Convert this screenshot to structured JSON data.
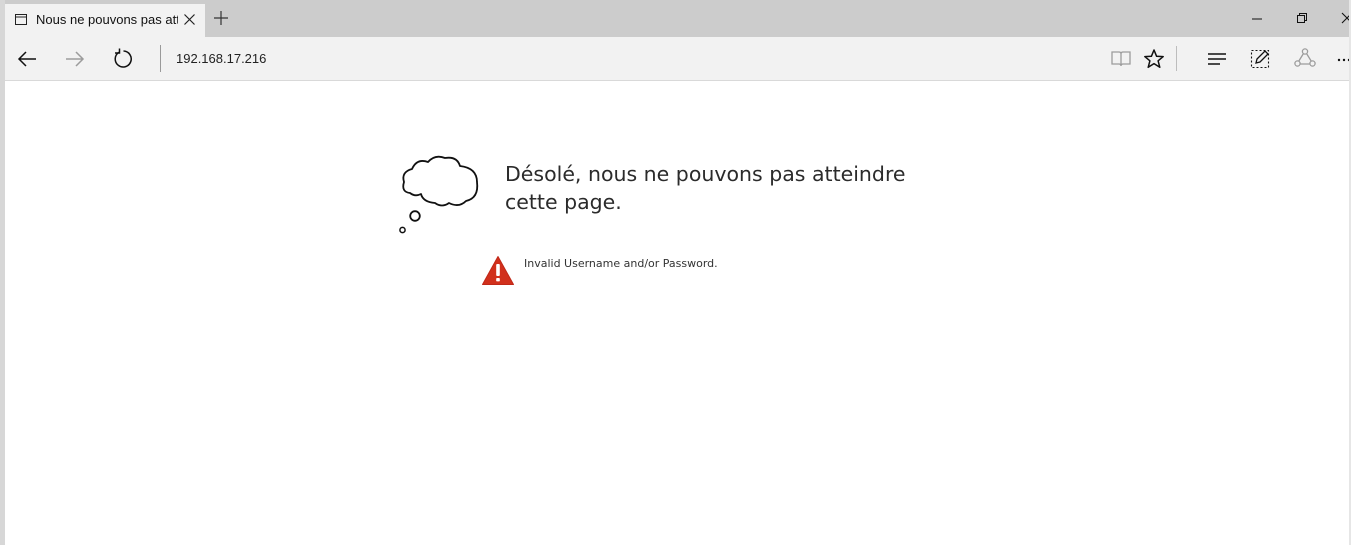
{
  "tab": {
    "title": "Nous ne pouvons pas atteindre cette page"
  },
  "address_bar": {
    "url": "192.168.17.216"
  },
  "error_page": {
    "headline": "Désolé, nous ne pouvons pas atteindre cette page.",
    "message": "Invalid Username and/or Password."
  },
  "icons": {
    "tab": "page-icon",
    "tab_close": "close-icon",
    "new_tab": "plus-icon",
    "minimize": "minimize-icon",
    "restore": "restore-icon",
    "close": "close-icon",
    "back": "arrow-left-icon",
    "forward": "arrow-right-icon",
    "refresh": "refresh-icon",
    "reading_view": "book-icon",
    "favorite": "star-icon",
    "hub": "hub-icon",
    "web_note": "pen-icon",
    "share": "share-icon",
    "more": "more-icon",
    "illustration": "thought-cloud-icon",
    "warning": "warning-icon"
  },
  "colors": {
    "warning": "#d1301c",
    "title_bar": "#cccccc",
    "nav_bar": "#f2f2f2"
  }
}
